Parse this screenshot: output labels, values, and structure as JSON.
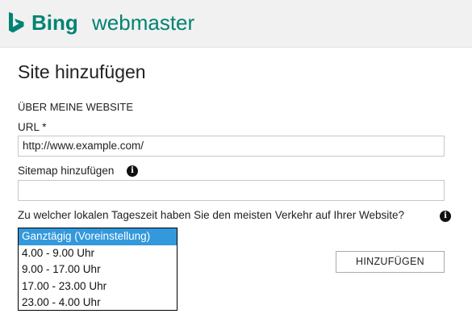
{
  "header": {
    "brand": "Bing",
    "product": "webmaster",
    "brand_color": "#008373",
    "logo_icon": "bing-b-logo"
  },
  "form": {
    "title": "Site hinzufügen",
    "section": "ÜBER MEINE WEBSITE",
    "url_label": "URL *",
    "url_value": "http://www.example.com/",
    "sitemap_label": "Sitemap hinzufügen",
    "sitemap_value": "",
    "info_icon": "info-icon",
    "traffic_question": "Zu welcher lokalen Tageszeit haben Sie den meisten Verkehr auf Ihrer Website?",
    "traffic_options": [
      "Ganztägig (Voreinstellung)",
      "4.00 - 9.00 Uhr",
      "9.00 - 17.00 Uhr",
      "17.00 - 23.00 Uhr",
      "23.00 - 4.00 Uhr"
    ],
    "selected_option": "Ganztägig (Voreinstellung)",
    "selected_color": "#3398dc",
    "submit_label": "HINZUFÜGEN"
  }
}
